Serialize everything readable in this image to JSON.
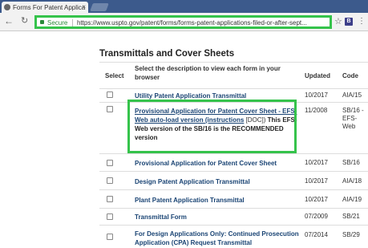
{
  "browser": {
    "tab_title": "Forms For Patent Applica",
    "tab_close": "×",
    "secure_label": "Secure",
    "url": "https://www.uspto.gov/patent/forms/forms-patent-applications-filed-or-after-sept...",
    "extension_label": "B"
  },
  "page": {
    "heading": "Transmittals and Cover Sheets",
    "columns": {
      "select": "Select",
      "description": "Select the description to view each form in your browser",
      "updated": "Updated",
      "code": "Code"
    },
    "rows": [
      {
        "description": "Utility Patent Application Transmittal",
        "updated": "10/2017",
        "code": "AIA/15"
      },
      {
        "link_text": "Provisional Application for Patent Cover Sheet - EFS-Web auto-load version (instructions",
        "doc_text": " [DOC])",
        "rest_text": " This EFS-Web version of the SB/16 is the RECOMMENDED version",
        "updated": "11/2008",
        "code": "SB/16 - EFS-Web"
      },
      {
        "description": "Provisional Application for Patent Cover Sheet",
        "updated": "10/2017",
        "code": "SB/16"
      },
      {
        "description": "Design Patent Application Transmittal",
        "updated": "10/2017",
        "code": "AIA/18"
      },
      {
        "description": "Plant Patent Application Transmittal",
        "updated": "10/2017",
        "code": "AIA/19"
      },
      {
        "description": "Transmittal Form",
        "updated": "07/2009",
        "code": "SB/21"
      },
      {
        "description": "For Design Applications Only: Continued Prosecution Application (CPA) Request Transmittal",
        "updated": "07/2014",
        "code": "SB/29"
      }
    ]
  },
  "colors": {
    "highlight": "#35c34b",
    "link": "#1a4474",
    "tabstrip": "#3c5a8c"
  }
}
